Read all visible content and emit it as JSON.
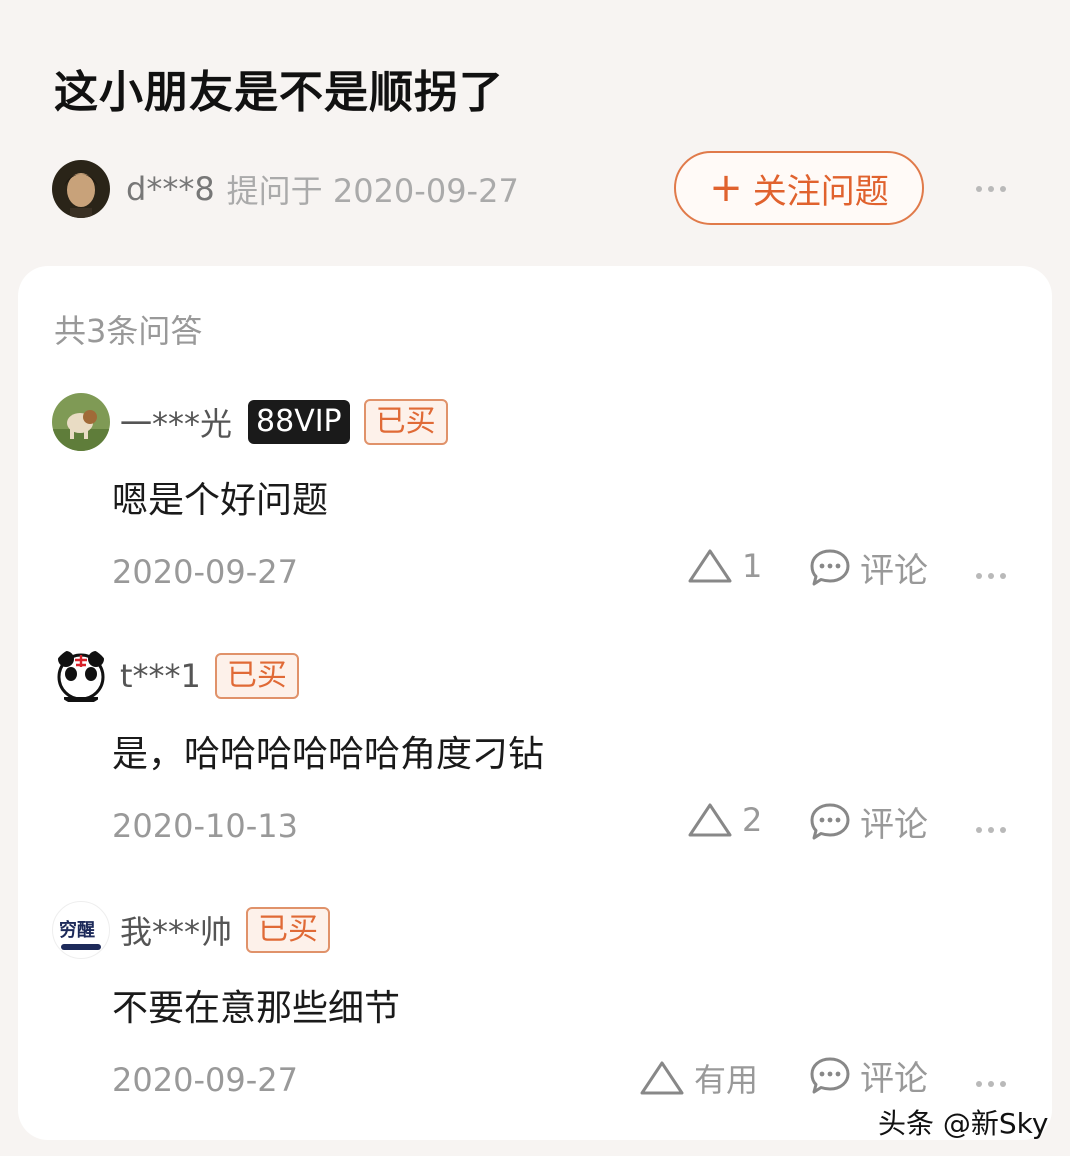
{
  "question": {
    "title": "这小朋友是不是顺拐了",
    "asker_name": "d***8",
    "asker_meta": "提问于 2020-09-27",
    "follow_label": "关注问题",
    "follow_icon": "plus-icon"
  },
  "answers_count": "共3条问答",
  "answers": [
    {
      "user": "一***光",
      "vip_badge": "88VIP",
      "bought_badge": "已买",
      "text": "嗯是个好问题",
      "date": "2020-09-27",
      "likes": "1",
      "comment_label": "评论"
    },
    {
      "user": "t***1",
      "bought_badge": "已买",
      "text": "是，哈哈哈哈哈哈角度刁钻",
      "date": "2020-10-13",
      "likes": "2",
      "comment_label": "评论"
    },
    {
      "user": "我***帅",
      "bought_badge": "已买",
      "avatar_text": "穷醒",
      "text": "不要在意那些细节",
      "date": "2020-09-27",
      "likes": "有用",
      "comment_label": "评论"
    }
  ],
  "watermark": "头条 @新Sky",
  "colors": {
    "accent": "#e0622e",
    "muted": "#999999",
    "card": "#ffffff",
    "background": "#f7f4f2"
  }
}
